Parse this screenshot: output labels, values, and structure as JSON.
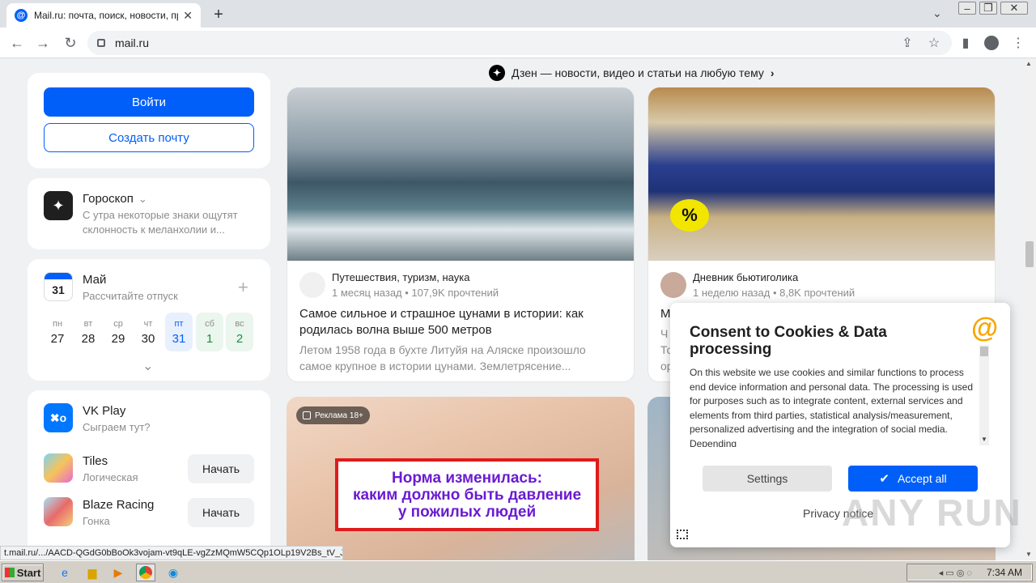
{
  "browser": {
    "tab_title": "Mail.ru: почта, поиск, новости, пр",
    "url": "mail.ru",
    "new_tab_label": "+"
  },
  "zen_banner": "Дзен — новости, видео и статьи на любую тему",
  "login": {
    "login_label": "Войти",
    "create_label": "Создать почту"
  },
  "horoscope": {
    "title": "Гороскоп",
    "text_line1": "С утра некоторые знаки ощутят",
    "text_line2": "склонность к меланхолии и..."
  },
  "calendar": {
    "icon_day": "31",
    "month": "Май",
    "subtitle": "Рассчитайте отпуск",
    "days": [
      {
        "wd": "пн",
        "n": "27"
      },
      {
        "wd": "вт",
        "n": "28"
      },
      {
        "wd": "ср",
        "n": "29"
      },
      {
        "wd": "чт",
        "n": "30"
      },
      {
        "wd": "пт",
        "n": "31"
      },
      {
        "wd": "сб",
        "n": "1"
      },
      {
        "wd": "вс",
        "n": "2"
      }
    ]
  },
  "games": {
    "vkplay_title": "VK Play",
    "vkplay_sub": "Сыграем тут?",
    "items": [
      {
        "title": "Tiles",
        "genre": "Логическая",
        "button": "Начать"
      },
      {
        "title": "Blaze Racing",
        "genre": "Гонка",
        "button": "Начать"
      }
    ]
  },
  "news": [
    {
      "source": "Путешествия, туризм, наука",
      "meta": "1 месяц назад • 107,9K прочтений",
      "title_line1": "Самое сильное и страшное цунами в истории: как",
      "title_line2": "родилась волна выше 500 метров",
      "desc_line1": "Летом 1958 года в бухте Литуйя на Аляске произошло",
      "desc_line2": "самое крупное в истории цунами. Землетрясение..."
    },
    {
      "source": "Дневник бьютиголика",
      "meta": "1 неделю назад • 8,8K прочтений",
      "title_fragment": "М",
      "desc_fragments": [
        "Ч",
        "То",
        "ор"
      ]
    }
  ],
  "ad": {
    "badge": "Реклама 18+",
    "headline_line1": "Норма изменилась:",
    "headline_line2": "каким должно быть давление",
    "headline_line3": "у пожилых людей"
  },
  "sale_badge": "%",
  "cookie": {
    "title_line1": "Consent to Cookies & Data",
    "title_line2": "processing",
    "body": "On this website we use cookies and similar functions to process end device information and personal data. The processing is used for purposes such as to integrate content, external services and elements from third parties, statistical analysis/measurement, personalized advertising and the integration of social media. Depending",
    "settings_label": "Settings",
    "accept_label": "Accept all",
    "privacy_label": "Privacy notice"
  },
  "status_url": "t.mail.ru/.../AACD-QGdG0bBoOk3vojam-vt9qLE-vgZzMQmW5CQp1OLp19V2Bs_tV_J...",
  "taskbar": {
    "start_label": "Start",
    "clock": "7:34 AM"
  },
  "watermark": "ANY RUN",
  "colors": {
    "accent": "#005ff9",
    "page_bg": "#f0f1f3",
    "ad_text": "#6a1bd1",
    "ad_border": "#e01b1b",
    "sale_badge": "#f2e600"
  }
}
